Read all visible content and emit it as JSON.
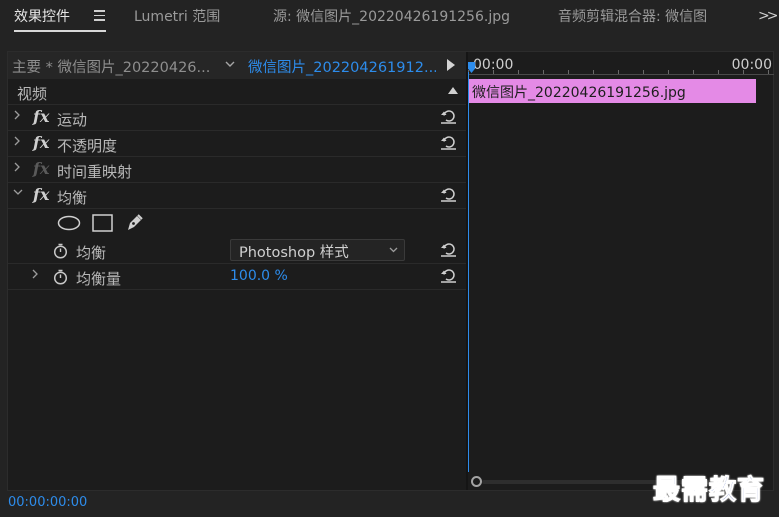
{
  "tabs": [
    {
      "label": "效果控件",
      "active": true
    },
    {
      "label": "Lumetri 范围",
      "active": false
    },
    {
      "label": "源: 微信图片_20220426191256.jpg",
      "active": false
    },
    {
      "label": "音频剪辑混合器: 微信图",
      "active": false
    }
  ],
  "overflow_icon": ">>",
  "selector": {
    "master": "主要 * 微信图片_20220426...",
    "clip": "微信图片_202204261912..."
  },
  "effects": {
    "section_label": "视频",
    "items": [
      {
        "label": "运动",
        "disabled": false
      },
      {
        "label": "不透明度",
        "disabled": false
      },
      {
        "label": "时间重映射",
        "disabled": true
      },
      {
        "label": "均衡",
        "disabled": false
      }
    ],
    "params": {
      "equalize_label": "均衡",
      "equalize_value": "Photoshop 样式",
      "amount_label": "均衡量",
      "amount_value": "100.0 %"
    }
  },
  "timeline": {
    "start_time": "00:00",
    "end_time": "00:00",
    "clip_name": "微信图片_20220426191256.jpg"
  },
  "timecode": "00:00:00:00",
  "watermark": "最需教育",
  "colors": {
    "accent": "#2d8ceb",
    "clip": "#e48ae6"
  }
}
